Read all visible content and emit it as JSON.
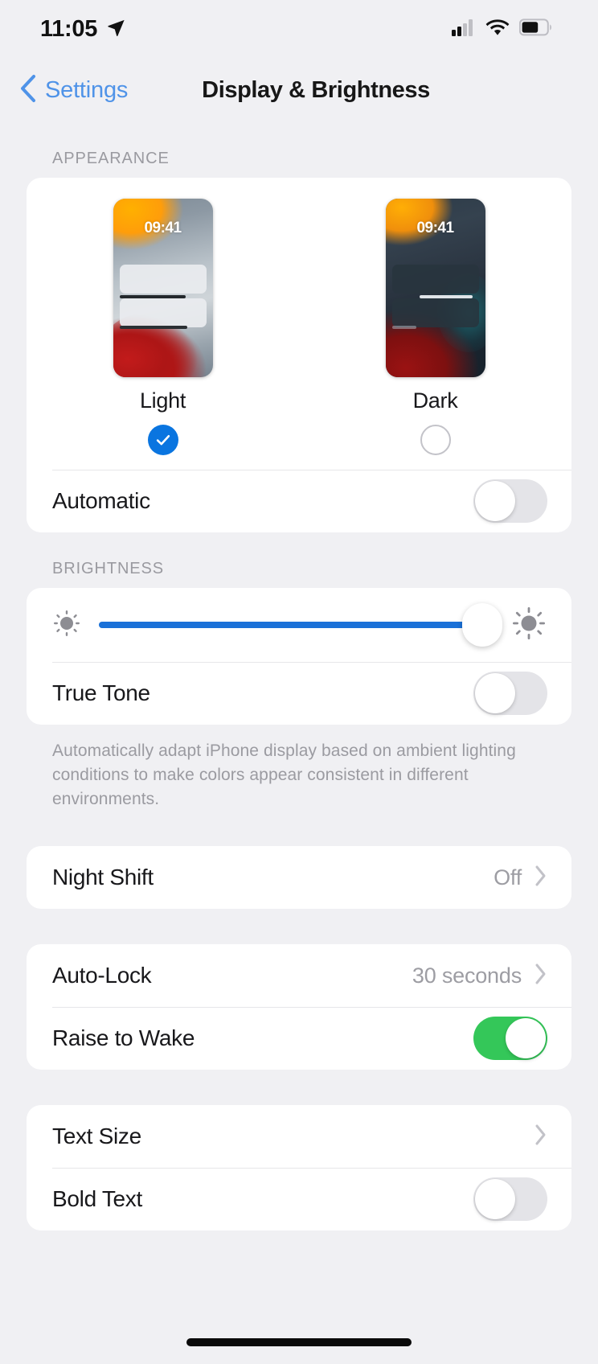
{
  "status_bar": {
    "time": "11:05",
    "location_icon": "location-arrow-icon",
    "cellular_icon": "cellular-signal-icon",
    "cellular_bars_filled": 2,
    "cellular_bars_total": 4,
    "wifi_icon": "wifi-icon",
    "battery_icon": "battery-icon",
    "battery_level_percent": 60
  },
  "nav": {
    "back_label": "Settings",
    "back_icon": "chevron-left-icon",
    "title": "Display & Brightness"
  },
  "appearance": {
    "header": "APPEARANCE",
    "options": [
      {
        "label": "Light",
        "selected": true,
        "preview_time": "09:41"
      },
      {
        "label": "Dark",
        "selected": false,
        "preview_time": "09:41"
      }
    ],
    "automatic": {
      "label": "Automatic",
      "enabled": false
    }
  },
  "brightness": {
    "header": "BRIGHTNESS",
    "slider": {
      "value_percent": 97,
      "low_icon": "sun-small-icon",
      "high_icon": "sun-large-icon",
      "fill_color": "#1a71d8"
    },
    "true_tone": {
      "label": "True Tone",
      "enabled": false
    },
    "footer": "Automatically adapt iPhone display based on ambient lighting conditions to make colors appear consistent in different environments."
  },
  "night_shift": {
    "label": "Night Shift",
    "value": "Off",
    "chevron_icon": "chevron-right-icon"
  },
  "lock_section": {
    "auto_lock": {
      "label": "Auto-Lock",
      "value": "30 seconds",
      "chevron_icon": "chevron-right-icon"
    },
    "raise_to_wake": {
      "label": "Raise to Wake",
      "enabled": true
    }
  },
  "text_section": {
    "text_size": {
      "label": "Text Size",
      "chevron_icon": "chevron-right-icon"
    },
    "bold_text": {
      "label": "Bold Text",
      "enabled": false
    }
  },
  "colors": {
    "accent_blue": "#0a75e0",
    "toggle_on_green": "#34c759",
    "toggle_off_gray": "#e4e4e8",
    "page_background": "#f0f0f3",
    "card_background": "#ffffff"
  }
}
